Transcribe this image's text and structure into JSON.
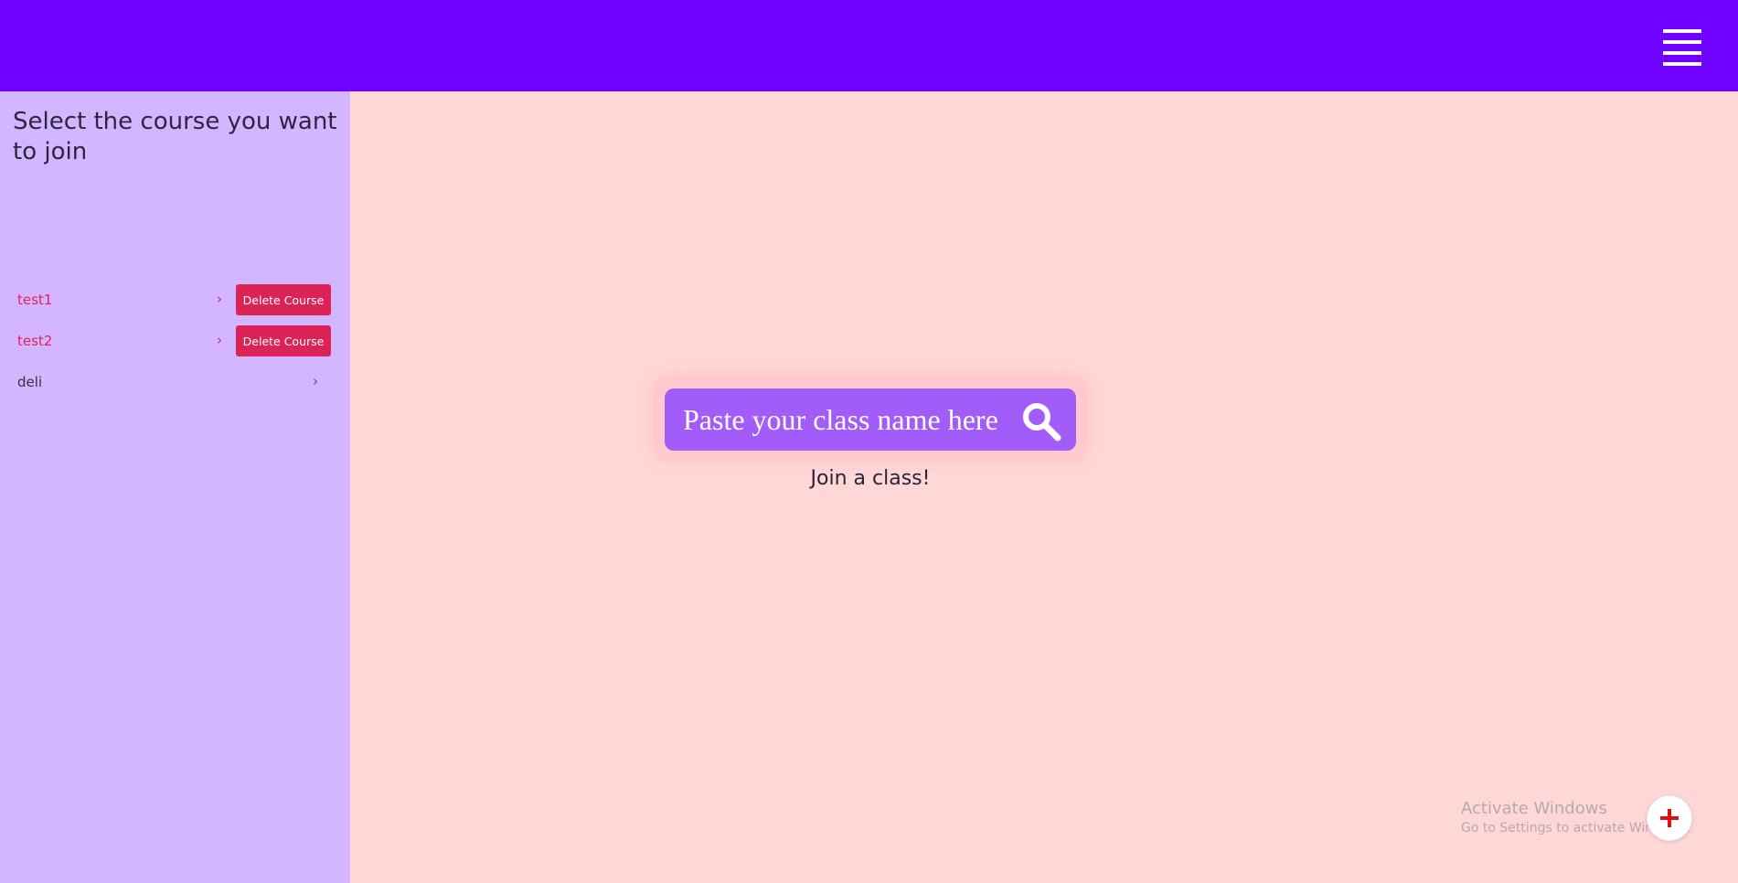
{
  "header": {
    "menu_icon": "hamburger-menu-icon",
    "bg_color": "#7000ff"
  },
  "sidebar": {
    "title": "Select the course you want to join",
    "courses": [
      {
        "name": "test1",
        "delete_label": "Delete Course"
      },
      {
        "name": "test2",
        "delete_label": "Delete Course"
      },
      {
        "name": "deli"
      }
    ],
    "chevron": "›"
  },
  "main": {
    "search": {
      "placeholder": "Paste your class name here",
      "icon": "search-icon"
    },
    "join_label": "Join a class!",
    "fab_icon": "plus-icon"
  },
  "watermark": {
    "title": "Activate Windows",
    "subtitle": "Go to Settings to activate Windows."
  },
  "colors": {
    "sidebar_bg": "#d4b5ff",
    "main_bg": "#ffd7d7",
    "accent": "#dc2358",
    "search_bg": "#a25cfa"
  }
}
